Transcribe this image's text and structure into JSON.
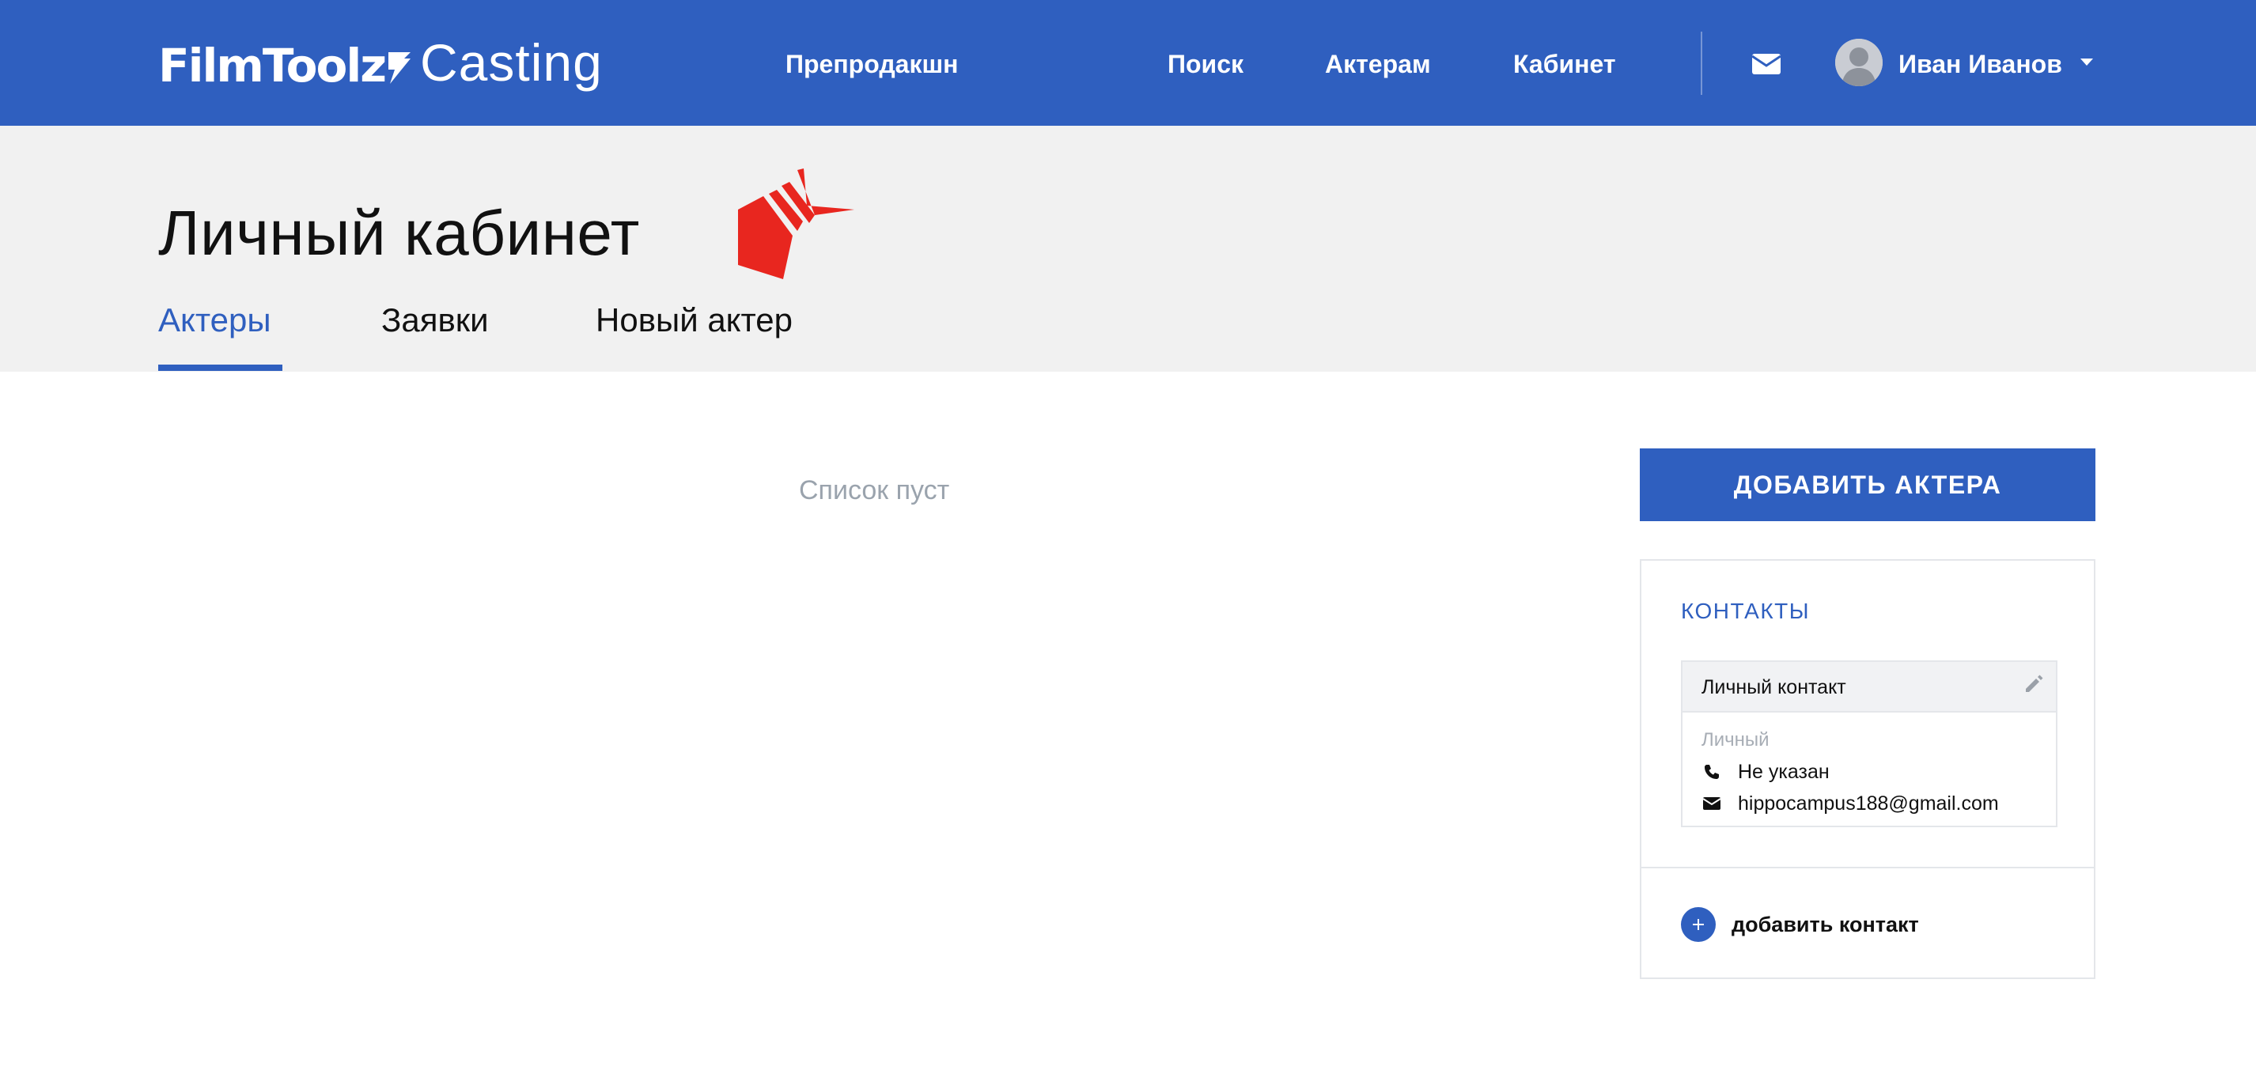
{
  "brand": {
    "logo_bold": "FilmToolz",
    "logo_light": "Casting"
  },
  "nav": {
    "items": [
      {
        "label": "Препродакшн"
      },
      {
        "label": "Поиск"
      },
      {
        "label": "Актерам"
      },
      {
        "label": "Кабинет"
      }
    ],
    "mail_icon": "envelope-icon",
    "user": {
      "name": "Иван Иванов",
      "avatar_icon": "user-avatar-icon",
      "caret_icon": "caret-down-icon"
    }
  },
  "page": {
    "title": "Личный кабинет",
    "tabs": [
      {
        "label": "Актеры",
        "active": true
      },
      {
        "label": "Заявки",
        "active": false
      },
      {
        "label": "Новый актер",
        "active": false
      }
    ]
  },
  "main": {
    "empty_message": "Список пуст"
  },
  "sidebar": {
    "add_actor_label": "ДОБАВИТЬ АКТЕРА",
    "contacts": {
      "heading": "КОНТАКТЫ",
      "card": {
        "title": "Личный контакт",
        "type": "Личный",
        "phone": "Не указан",
        "email": "hippocampus188@gmail.com"
      },
      "add_contact_label": "добавить контакт"
    }
  },
  "colors": {
    "primary": "#2f5fbf",
    "band": "#f1f1f1",
    "muted": "#9aa3ad",
    "accent_red": "#e8261f"
  }
}
